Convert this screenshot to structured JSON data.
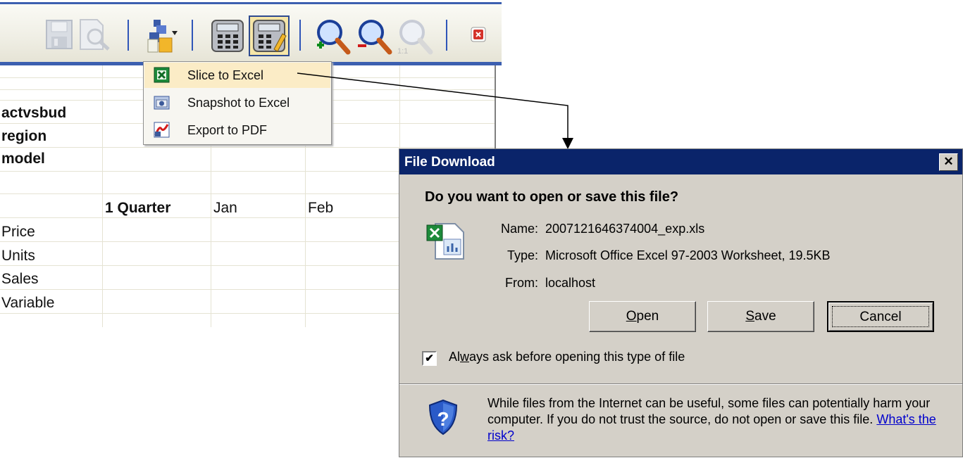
{
  "toolbar": {
    "buttons": [
      {
        "icon": "save-icon"
      },
      {
        "icon": "print-preview-icon"
      },
      {
        "icon": "export-dropdown-icon"
      },
      {
        "icon": "calculator-icon"
      },
      {
        "icon": "calculator-edit-icon"
      },
      {
        "icon": "zoom-in-icon"
      },
      {
        "icon": "zoom-out-icon"
      },
      {
        "icon": "zoom-actual-size-icon"
      },
      {
        "icon": "close-icon"
      }
    ],
    "zoom_actual_label": "1:1"
  },
  "export_menu": {
    "items": [
      {
        "label": "Slice to Excel",
        "icon": "excel-icon",
        "highlighted": true
      },
      {
        "label": "Snapshot to Excel",
        "icon": "snapshot-icon",
        "highlighted": false
      },
      {
        "label": "Export to PDF",
        "icon": "pdf-icon",
        "highlighted": false
      }
    ]
  },
  "sheet": {
    "dimensions": [
      "actvsbud",
      "region",
      "model"
    ],
    "column_headers": [
      "1 Quarter",
      "Jan",
      "Feb"
    ],
    "row_labels": [
      "Price",
      "Units",
      "Sales",
      "Variable"
    ]
  },
  "dialog": {
    "title": "File Download",
    "close_glyph": "✕",
    "question": "Do you want to open or save this file?",
    "name_label": "Name:",
    "name_value": "2007121646374004_exp.xls",
    "type_label": "Type:",
    "type_value": "Microsoft Office Excel 97-2003 Worksheet, 19.5KB",
    "from_label": "From:",
    "from_value": "localhost",
    "open_label": "Open",
    "save_label": "Save",
    "cancel_label": "Cancel",
    "checkbox_label": "Always ask before opening this type of file",
    "checkbox_checked": true,
    "warning_text": "While files from the Internet can be useful, some files can potentially harm your computer. If you do not trust the source, do not open or save this file.",
    "risk_link": "What's the risk?"
  }
}
